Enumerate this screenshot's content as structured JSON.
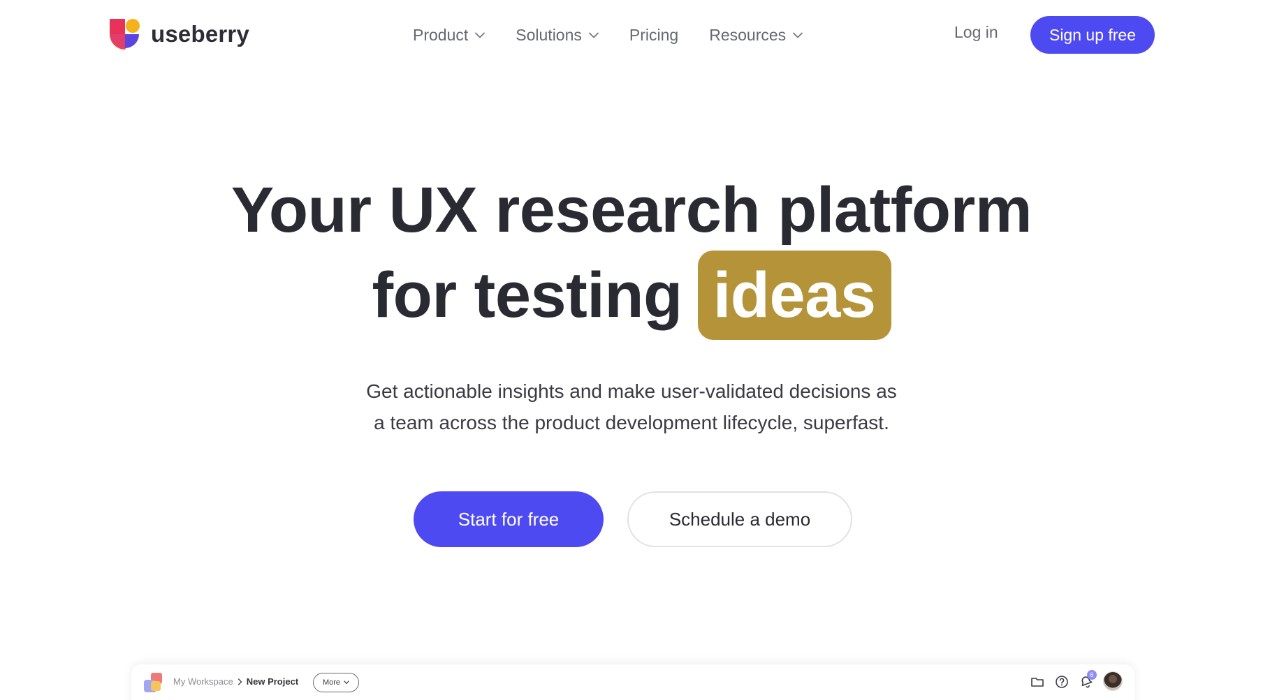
{
  "brand": {
    "name": "useberry"
  },
  "nav": {
    "items": [
      {
        "label": "Product",
        "has_dropdown": true
      },
      {
        "label": "Solutions",
        "has_dropdown": true
      },
      {
        "label": "Pricing",
        "has_dropdown": false
      },
      {
        "label": "Resources",
        "has_dropdown": true
      }
    ],
    "login_label": "Log in",
    "signup_label": "Sign up free"
  },
  "hero": {
    "headline_line1": "Your UX research platform",
    "headline_line2_lead": "for testing",
    "headline_highlight": "ideas",
    "subtitle_line1": "Get actionable insights and make user-validated decisions as",
    "subtitle_line2": "a team across the product development lifecycle, superfast.",
    "cta_primary": "Start for free",
    "cta_secondary": "Schedule a demo"
  },
  "app_preview": {
    "breadcrumb": {
      "workspace": "My Workspace",
      "project": "New Project"
    },
    "more_label": "More",
    "notification_count": "6",
    "icons": [
      "folder-icon",
      "help-icon",
      "notification-icon",
      "avatar"
    ]
  },
  "colors": {
    "accent": "#4e4af2",
    "highlight": "#b59339",
    "text_dark": "#2a2a32",
    "text_muted": "#666871"
  }
}
